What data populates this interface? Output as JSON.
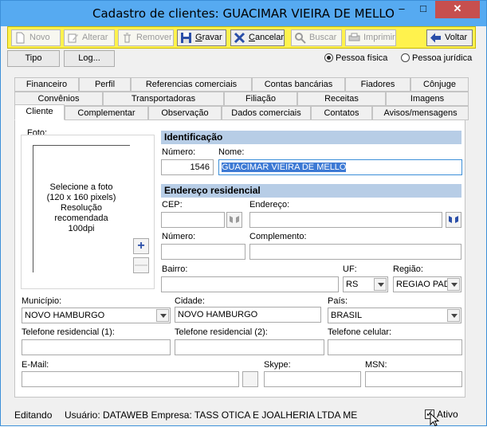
{
  "window": {
    "title": "Cadastro de clientes: GUACIMAR VIEIRA DE MELLO",
    "min_glyph": "–",
    "max_glyph": "□",
    "close_glyph": "✕"
  },
  "toolbar": {
    "novo": "Novo",
    "alterar": "Alterar",
    "remover": "Remover",
    "gravar": "Gravar",
    "cancelar": "Cancelar",
    "buscar": "Buscar",
    "imprimir": "Imprimir",
    "voltar": "Voltar"
  },
  "buttons": {
    "tipo": "Tipo",
    "log": "Log..."
  },
  "person_type": {
    "fisica": "Pessoa física",
    "juridica": "Pessoa jurídica",
    "selected": "fisica"
  },
  "tabs": {
    "row1": [
      "Financeiro",
      "Perfil",
      "Referencias comerciais",
      "Contas bancárias",
      "Fiadores",
      "Cônjuge"
    ],
    "row2": [
      "Convênios",
      "Transportadoras",
      "Filiação",
      "Receitas",
      "Imagens"
    ],
    "row3": [
      "Cliente",
      "Complementar",
      "Observação",
      "Dados comerciais",
      "Contatos",
      "Avisos/mensagens"
    ],
    "active": "Cliente"
  },
  "photo": {
    "label": "Foto:",
    "line1": "Selecione a foto",
    "line2": "(120 x 160 pixels)",
    "line3": "Resolução",
    "line4": "recomendada",
    "line5": "100dpi",
    "add": "+",
    "remove": "—"
  },
  "identificacao": {
    "header": "Identificação",
    "numero_label": "Número:",
    "numero_value": "1546",
    "nome_label": "Nome:",
    "nome_value": "GUACIMAR VIEIRA DE MELLO"
  },
  "endereco": {
    "header": "Endereço residencial",
    "cep_label": "CEP:",
    "cep_value": "",
    "endereco_label": "Endereço:",
    "endereco_value": "",
    "numero_label": "Número:",
    "numero_value": "",
    "complemento_label": "Complemento:",
    "complemento_value": "",
    "bairro_label": "Bairro:",
    "bairro_value": "",
    "uf_label": "UF:",
    "uf_value": "RS",
    "regiao_label": "Região:",
    "regiao_value": "REGIAO PAD",
    "municipio_label": "Município:",
    "municipio_value": "NOVO HAMBURGO",
    "cidade_label": "Cidade:",
    "cidade_value": "NOVO HAMBURGO",
    "pais_label": "País:",
    "pais_value": "BRASIL"
  },
  "contato": {
    "tel1_label": "Telefone residencial (1):",
    "tel1_value": "",
    "tel2_label": "Telefone residencial (2):",
    "tel2_value": "",
    "cel_label": "Telefone celular:",
    "cel_value": "",
    "email_label": "E-Mail:",
    "email_value": "",
    "skype_label": "Skype:",
    "skype_value": "",
    "msn_label": "MSN:",
    "msn_value": ""
  },
  "status": {
    "mode": "Editando",
    "user_info": "Usuário: DATAWEB Empresa: TASS OTICA E JOALHERIA LTDA ME",
    "ativo_label": "Ativo",
    "ativo_checked": true
  },
  "colors": {
    "titlebar": "#56aaf1",
    "toolbar": "#fff24d",
    "section_header": "#b7cde6",
    "selection": "#3c79d4",
    "close": "#c74f4e"
  }
}
